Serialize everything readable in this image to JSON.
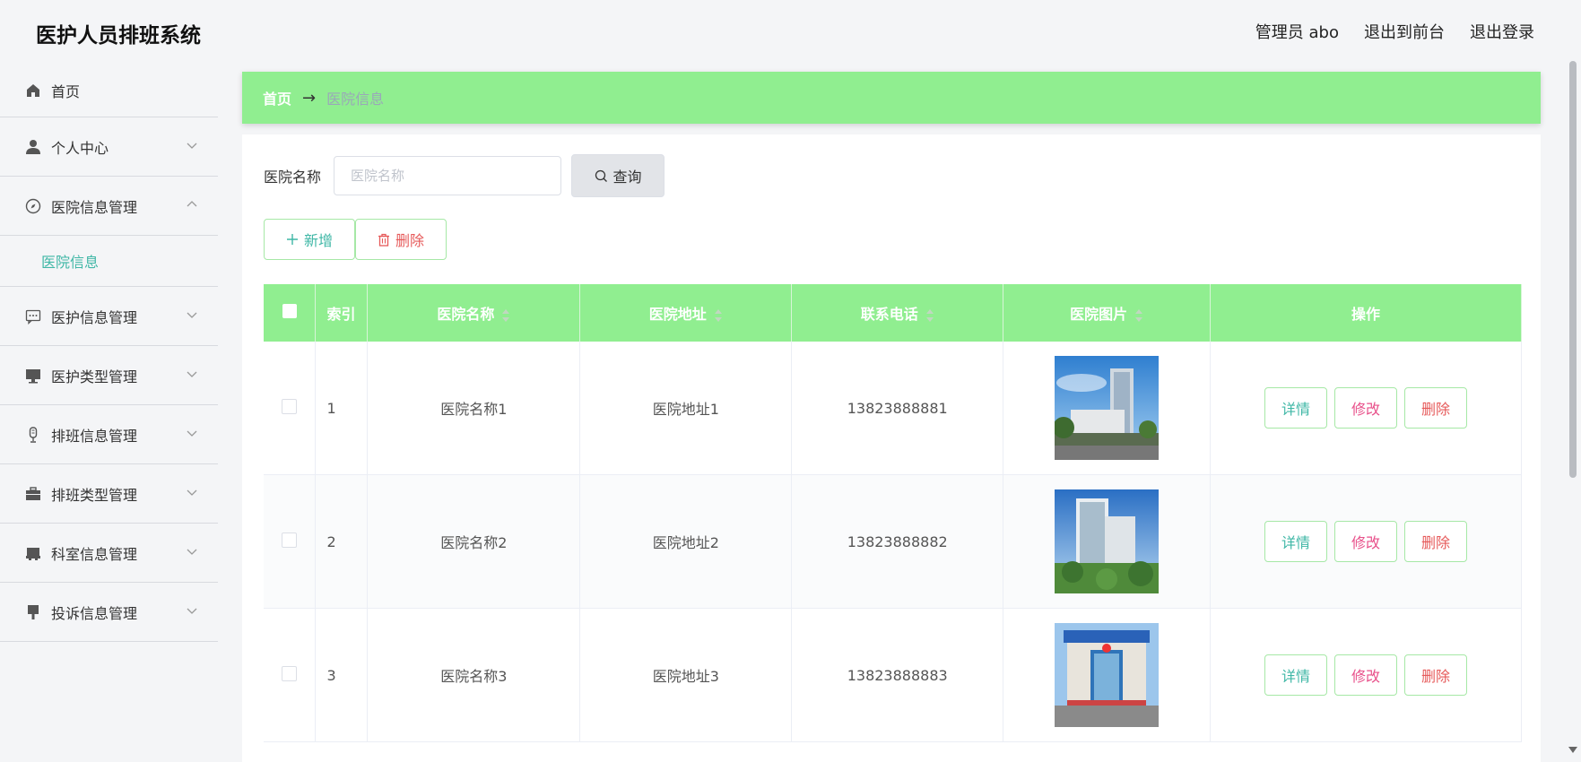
{
  "header": {
    "title": "医护人员排班系统",
    "admin": "管理员 abo",
    "to_front": "退出到前台",
    "logout": "退出登录"
  },
  "sidebar": {
    "items": [
      {
        "label": "首页",
        "icon": "home-icon"
      },
      {
        "label": "个人中心",
        "icon": "user-icon"
      },
      {
        "label": "医院信息管理",
        "icon": "compass-icon",
        "expanded": true,
        "children": [
          "医院信息"
        ]
      },
      {
        "label": "医护信息管理",
        "icon": "chat-icon"
      },
      {
        "label": "医护类型管理",
        "icon": "monitor-icon"
      },
      {
        "label": "排班信息管理",
        "icon": "microphone-icon"
      },
      {
        "label": "排班类型管理",
        "icon": "briefcase-icon"
      },
      {
        "label": "科室信息管理",
        "icon": "printer-icon"
      },
      {
        "label": "投诉信息管理",
        "icon": "brush-icon"
      }
    ]
  },
  "breadcrumb": {
    "home": "首页",
    "current": "医院信息"
  },
  "search": {
    "label": "医院名称",
    "placeholder": "医院名称",
    "button": "查询"
  },
  "actions": {
    "add": "新增",
    "delete": "删除"
  },
  "table": {
    "headers": [
      "索引",
      "医院名称",
      "医院地址",
      "联系电话",
      "医院图片",
      "操作"
    ],
    "rows": [
      {
        "index": "1",
        "name": "医院名称1",
        "address": "医院地址1",
        "phone": "13823888881"
      },
      {
        "index": "2",
        "name": "医院名称2",
        "address": "医院地址2",
        "phone": "13823888882"
      },
      {
        "index": "3",
        "name": "医院名称3",
        "address": "医院地址3",
        "phone": "13823888883"
      }
    ],
    "ops": {
      "detail": "详情",
      "edit": "修改",
      "delete": "删除"
    }
  },
  "colors": {
    "accent": "#90ee90",
    "teal": "#3fb7a6",
    "danger": "#e65a5a",
    "pink": "#e8508a"
  }
}
